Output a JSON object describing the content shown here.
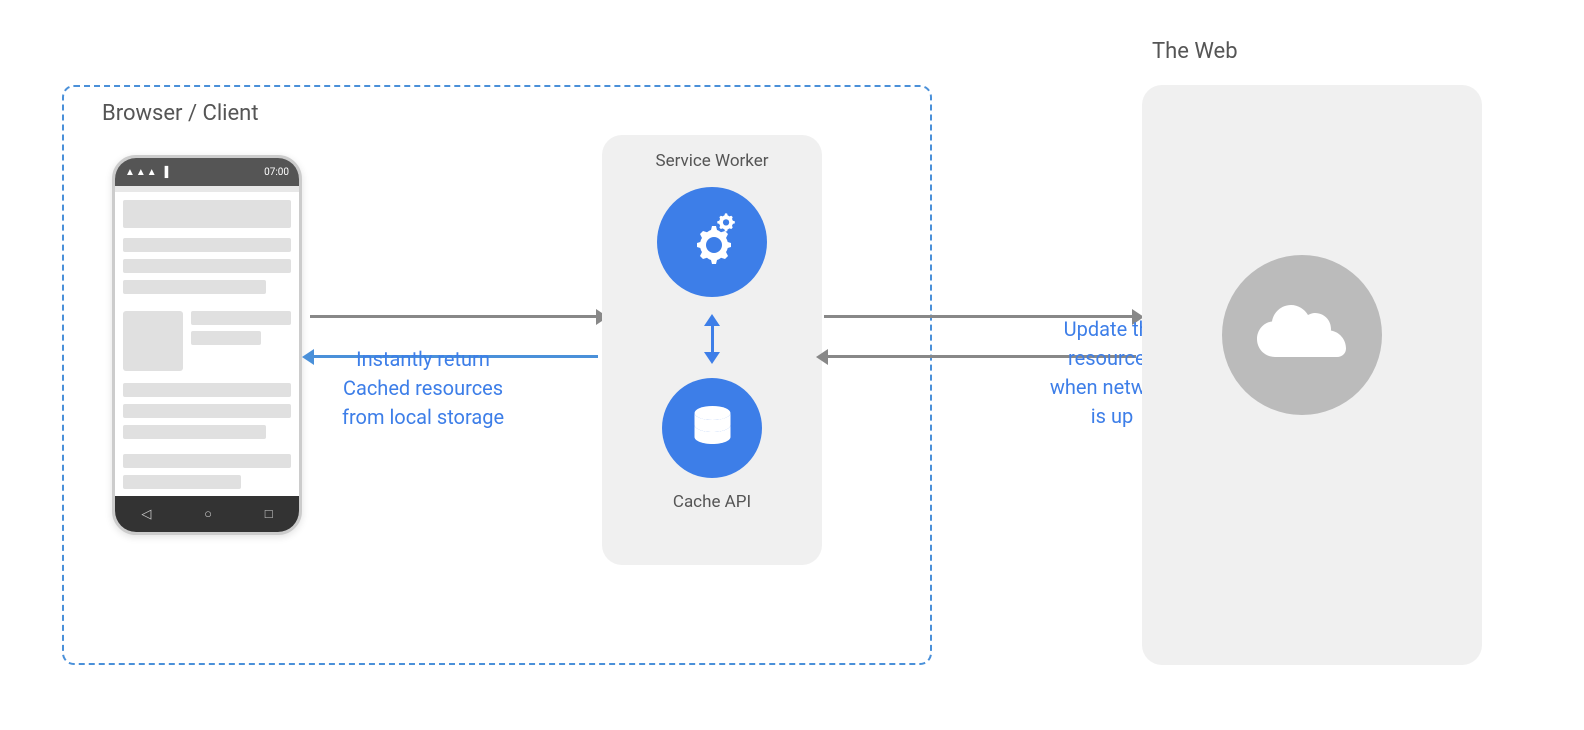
{
  "diagram": {
    "browser_client_label": "Browser / Client",
    "the_web_label": "The Web",
    "service_worker_label": "Service Worker",
    "cache_api_label": "Cache API",
    "label_phone_sw_line1": "Instantly return",
    "label_phone_sw_line2": "Cached resources",
    "label_phone_sw_line3": "from local storage",
    "label_sw_web_line1": "Update the",
    "label_sw_web_line2": "resources",
    "label_sw_web_line3": "when network",
    "label_sw_web_line4": "is up",
    "phone_nav_back": "◁",
    "phone_nav_home": "○",
    "phone_nav_recents": "□"
  }
}
